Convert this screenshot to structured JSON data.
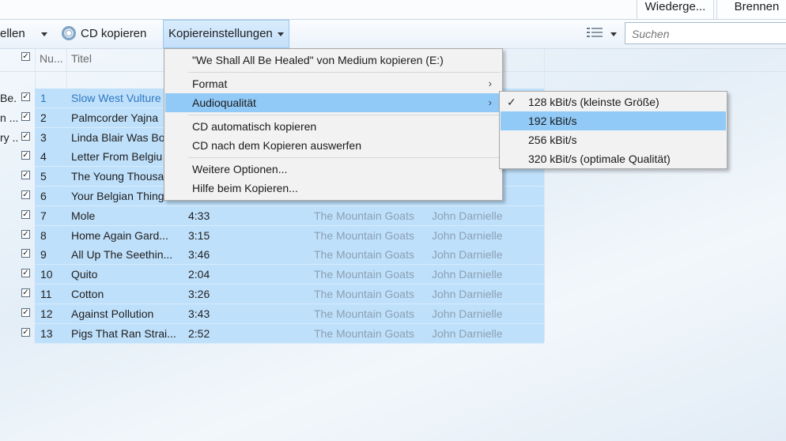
{
  "top_tabs": [
    "Wiederge...",
    "Brennen"
  ],
  "toolbar": {
    "left_partial": "ellen",
    "rip_cd": "CD kopieren",
    "rip_settings": "Kopiereinstellungen",
    "search_placeholder": "Suchen"
  },
  "columns": {
    "number": "Nu...",
    "title": "Titel"
  },
  "left_truncated": [
    "Be...",
    "n ...",
    "ry ..."
  ],
  "tracks": [
    {
      "num": "1",
      "title": "Slow West Vulture",
      "length": "",
      "artist": "",
      "composer": ""
    },
    {
      "num": "2",
      "title": "Palmcorder Yajna",
      "length": "",
      "artist": "",
      "composer": ""
    },
    {
      "num": "3",
      "title": "Linda Blair Was Bo",
      "length": "",
      "artist": "",
      "composer": ""
    },
    {
      "num": "4",
      "title": "Letter From Belgiu",
      "length": "",
      "artist": "",
      "composer": ""
    },
    {
      "num": "5",
      "title": "The Young Thousa",
      "length": "",
      "artist": "",
      "composer": ""
    },
    {
      "num": "6",
      "title": "Your Belgian Things",
      "length": "",
      "artist": "",
      "composer": ""
    },
    {
      "num": "7",
      "title": "Mole",
      "length": "4:33",
      "artist": "The Mountain Goats",
      "composer": "John Darnielle"
    },
    {
      "num": "8",
      "title": "Home Again Gard...",
      "length": "3:15",
      "artist": "The Mountain Goats",
      "composer": "John Darnielle"
    },
    {
      "num": "9",
      "title": "All Up The Seethin...",
      "length": "3:46",
      "artist": "The Mountain Goats",
      "composer": "John Darnielle"
    },
    {
      "num": "10",
      "title": "Quito",
      "length": "2:04",
      "artist": "The Mountain Goats",
      "composer": "John Darnielle"
    },
    {
      "num": "11",
      "title": "Cotton",
      "length": "3:26",
      "artist": "The Mountain Goats",
      "composer": "John Darnielle"
    },
    {
      "num": "12",
      "title": "Against Pollution",
      "length": "3:43",
      "artist": "The Mountain Goats",
      "composer": "John Darnielle"
    },
    {
      "num": "13",
      "title": "Pigs That Ran Strai...",
      "length": "2:52",
      "artist": "The Mountain Goats",
      "composer": "John Darnielle"
    }
  ],
  "menu": {
    "rip_from": "\"We Shall All Be Healed\" von Medium kopieren (E:)",
    "format": "Format",
    "audio_quality": "Audioqualität",
    "auto_rip": "CD automatisch kopieren",
    "eject_after": "CD nach dem Kopieren auswerfen",
    "more_options": "Weitere Optionen...",
    "help": "Hilfe beim Kopieren..."
  },
  "submenu": {
    "q128": "128 kBit/s (kleinste Größe)",
    "q192": "192 kBit/s",
    "q256": "256 kBit/s",
    "q320": "320 kBit/s (optimale Qualität)",
    "checked": "q128",
    "highlighted": "q192"
  },
  "colors": {
    "selection": "#bfe0fb",
    "menu_highlight": "#91c9f7",
    "dim_text": "#8aa0b3"
  }
}
